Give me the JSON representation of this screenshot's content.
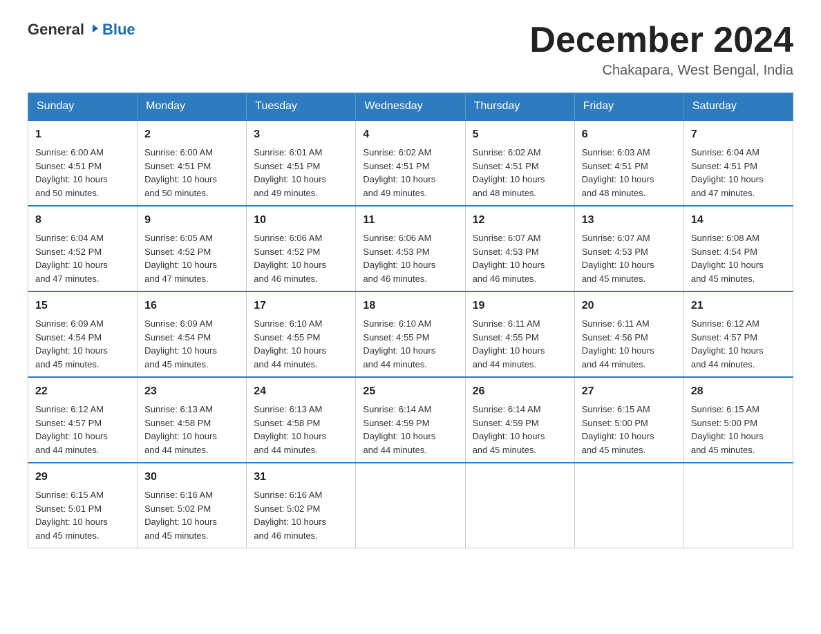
{
  "logo": {
    "general": "General",
    "blue": "Blue"
  },
  "title": "December 2024",
  "location": "Chakapara, West Bengal, India",
  "days_of_week": [
    "Sunday",
    "Monday",
    "Tuesday",
    "Wednesday",
    "Thursday",
    "Friday",
    "Saturday"
  ],
  "weeks": [
    [
      {
        "day": "1",
        "sunrise": "6:00 AM",
        "sunset": "4:51 PM",
        "daylight": "10 hours and 50 minutes."
      },
      {
        "day": "2",
        "sunrise": "6:00 AM",
        "sunset": "4:51 PM",
        "daylight": "10 hours and 50 minutes."
      },
      {
        "day": "3",
        "sunrise": "6:01 AM",
        "sunset": "4:51 PM",
        "daylight": "10 hours and 49 minutes."
      },
      {
        "day": "4",
        "sunrise": "6:02 AM",
        "sunset": "4:51 PM",
        "daylight": "10 hours and 49 minutes."
      },
      {
        "day": "5",
        "sunrise": "6:02 AM",
        "sunset": "4:51 PM",
        "daylight": "10 hours and 48 minutes."
      },
      {
        "day": "6",
        "sunrise": "6:03 AM",
        "sunset": "4:51 PM",
        "daylight": "10 hours and 48 minutes."
      },
      {
        "day": "7",
        "sunrise": "6:04 AM",
        "sunset": "4:51 PM",
        "daylight": "10 hours and 47 minutes."
      }
    ],
    [
      {
        "day": "8",
        "sunrise": "6:04 AM",
        "sunset": "4:52 PM",
        "daylight": "10 hours and 47 minutes."
      },
      {
        "day": "9",
        "sunrise": "6:05 AM",
        "sunset": "4:52 PM",
        "daylight": "10 hours and 47 minutes."
      },
      {
        "day": "10",
        "sunrise": "6:06 AM",
        "sunset": "4:52 PM",
        "daylight": "10 hours and 46 minutes."
      },
      {
        "day": "11",
        "sunrise": "6:06 AM",
        "sunset": "4:53 PM",
        "daylight": "10 hours and 46 minutes."
      },
      {
        "day": "12",
        "sunrise": "6:07 AM",
        "sunset": "4:53 PM",
        "daylight": "10 hours and 46 minutes."
      },
      {
        "day": "13",
        "sunrise": "6:07 AM",
        "sunset": "4:53 PM",
        "daylight": "10 hours and 45 minutes."
      },
      {
        "day": "14",
        "sunrise": "6:08 AM",
        "sunset": "4:54 PM",
        "daylight": "10 hours and 45 minutes."
      }
    ],
    [
      {
        "day": "15",
        "sunrise": "6:09 AM",
        "sunset": "4:54 PM",
        "daylight": "10 hours and 45 minutes."
      },
      {
        "day": "16",
        "sunrise": "6:09 AM",
        "sunset": "4:54 PM",
        "daylight": "10 hours and 45 minutes."
      },
      {
        "day": "17",
        "sunrise": "6:10 AM",
        "sunset": "4:55 PM",
        "daylight": "10 hours and 44 minutes."
      },
      {
        "day": "18",
        "sunrise": "6:10 AM",
        "sunset": "4:55 PM",
        "daylight": "10 hours and 44 minutes."
      },
      {
        "day": "19",
        "sunrise": "6:11 AM",
        "sunset": "4:55 PM",
        "daylight": "10 hours and 44 minutes."
      },
      {
        "day": "20",
        "sunrise": "6:11 AM",
        "sunset": "4:56 PM",
        "daylight": "10 hours and 44 minutes."
      },
      {
        "day": "21",
        "sunrise": "6:12 AM",
        "sunset": "4:57 PM",
        "daylight": "10 hours and 44 minutes."
      }
    ],
    [
      {
        "day": "22",
        "sunrise": "6:12 AM",
        "sunset": "4:57 PM",
        "daylight": "10 hours and 44 minutes."
      },
      {
        "day": "23",
        "sunrise": "6:13 AM",
        "sunset": "4:58 PM",
        "daylight": "10 hours and 44 minutes."
      },
      {
        "day": "24",
        "sunrise": "6:13 AM",
        "sunset": "4:58 PM",
        "daylight": "10 hours and 44 minutes."
      },
      {
        "day": "25",
        "sunrise": "6:14 AM",
        "sunset": "4:59 PM",
        "daylight": "10 hours and 44 minutes."
      },
      {
        "day": "26",
        "sunrise": "6:14 AM",
        "sunset": "4:59 PM",
        "daylight": "10 hours and 45 minutes."
      },
      {
        "day": "27",
        "sunrise": "6:15 AM",
        "sunset": "5:00 PM",
        "daylight": "10 hours and 45 minutes."
      },
      {
        "day": "28",
        "sunrise": "6:15 AM",
        "sunset": "5:00 PM",
        "daylight": "10 hours and 45 minutes."
      }
    ],
    [
      {
        "day": "29",
        "sunrise": "6:15 AM",
        "sunset": "5:01 PM",
        "daylight": "10 hours and 45 minutes."
      },
      {
        "day": "30",
        "sunrise": "6:16 AM",
        "sunset": "5:02 PM",
        "daylight": "10 hours and 45 minutes."
      },
      {
        "day": "31",
        "sunrise": "6:16 AM",
        "sunset": "5:02 PM",
        "daylight": "10 hours and 46 minutes."
      },
      null,
      null,
      null,
      null
    ]
  ],
  "sunrise_label": "Sunrise:",
  "sunset_label": "Sunset:",
  "daylight_label": "Daylight:"
}
